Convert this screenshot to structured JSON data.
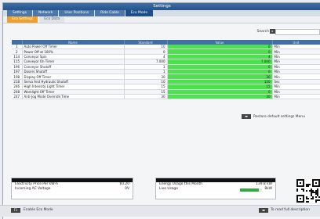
{
  "window": {
    "title": "Settings"
  },
  "tabs": [
    {
      "label": "Settings",
      "active": false
    },
    {
      "label": "Network",
      "active": false
    },
    {
      "label": "User Positions",
      "active": false
    },
    {
      "label": "Ride Cable",
      "active": false
    },
    {
      "label": "Eco Mode",
      "active": true
    }
  ],
  "subtabs": [
    {
      "label": "Eco Settings",
      "active": true
    },
    {
      "label": "Eco Data",
      "active": false
    }
  ],
  "search": {
    "label": "Search",
    "button_label": "▸",
    "value": "",
    "placeholder": ""
  },
  "table": {
    "columns": [
      "",
      "Name",
      "Standard",
      "",
      "Value",
      "Unit"
    ],
    "rows": [
      {
        "id": "1",
        "name": "Auto Power Off Timer",
        "flag": "",
        "standard": "10",
        "value": "0",
        "unit": "Min"
      },
      {
        "id": "2",
        "name": "Power Off at 100%",
        "flag": "X",
        "standard": "0",
        "value": "0",
        "unit": "Min"
      },
      {
        "id": "114",
        "name": "Conveyor Spin",
        "flag": "",
        "standard": "4",
        "value": "4",
        "unit": "Min"
      },
      {
        "id": "115",
        "name": "Conveyor On Timer",
        "flag": "",
        "standard": "7.000",
        "value": "7.000",
        "unit": "Min"
      },
      {
        "id": "196",
        "name": "Conveyor Shutoff",
        "flag": "",
        "standard": "1",
        "value": "0",
        "unit": "Min"
      },
      {
        "id": "197",
        "name": "Dosers Shutoff",
        "flag": "",
        "standard": "1",
        "value": "0",
        "unit": "Min"
      },
      {
        "id": "198",
        "name": "Display Off Timer",
        "flag": "",
        "standard": "30",
        "value": "30",
        "unit": "Min"
      },
      {
        "id": "218",
        "name": "Servo And Hydraulic Shutoff",
        "flag": "",
        "standard": "10",
        "value": "120",
        "unit": "Sec"
      },
      {
        "id": "246",
        "name": "High Intensity Light Timer",
        "flag": "",
        "standard": "15",
        "value": "15",
        "unit": "Min"
      },
      {
        "id": "248",
        "name": "Worklight Off Timer",
        "flag": "",
        "standard": "15",
        "value": "0",
        "unit": "Min"
      },
      {
        "id": "247",
        "name": "Anti-Jog Mode Override Time",
        "flag": "",
        "standard": "30",
        "value": "30",
        "unit": "Min"
      }
    ]
  },
  "restore": {
    "button_label": "▬",
    "label": "Restore default settings Menu"
  },
  "cost_panel": {
    "rows": [
      {
        "label": "Electricity Price Per kW-h",
        "value": "$0.20"
      },
      {
        "label": "Incoming AC Voltage",
        "value": "0V"
      }
    ]
  },
  "energy_panel": {
    "rows": [
      {
        "label": "Energy Usage this Month",
        "value": "139.8 kW"
      },
      {
        "label": "Live Usage",
        "value": "8kW"
      }
    ],
    "live_usage_fraction": 0.85,
    "bar_color": "#2fae3f"
  },
  "bottom": {
    "left_button": "F1",
    "left_label": "Enable Eco Mode",
    "right_button": "▬",
    "right_label": "To read full description"
  },
  "colors": {
    "accent": "#3f6fa8",
    "value_cell": "#4fe04f",
    "active_subtab": "#f0a024"
  }
}
